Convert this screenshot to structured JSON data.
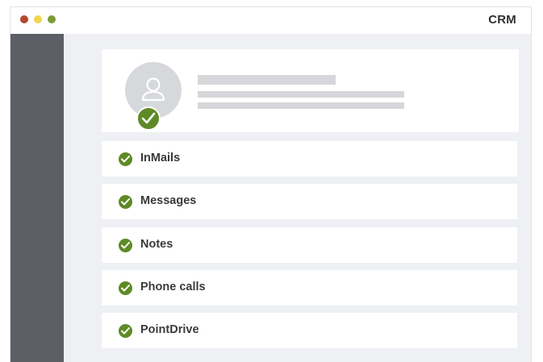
{
  "window": {
    "title": "CRM",
    "controls": [
      "close",
      "minimize",
      "maximize"
    ]
  },
  "profile": {
    "avatar_icon": "user-icon",
    "verified_icon": "checkmark-icon"
  },
  "checklist": {
    "items": [
      {
        "label": "InMails",
        "icon": "checkmark-icon"
      },
      {
        "label": "Messages",
        "icon": "checkmark-icon"
      },
      {
        "label": "Notes",
        "icon": "checkmark-icon"
      },
      {
        "label": "Phone calls",
        "icon": "checkmark-icon"
      },
      {
        "label": "PointDrive",
        "icon": "checkmark-icon"
      }
    ]
  },
  "colors": {
    "sidebar": "#5c6066",
    "content_bg": "#eef0f3",
    "check_green": "#5e8a26",
    "dot_red": "#b5472b",
    "dot_yellow": "#f2d44f",
    "dot_green": "#7a9c34"
  }
}
